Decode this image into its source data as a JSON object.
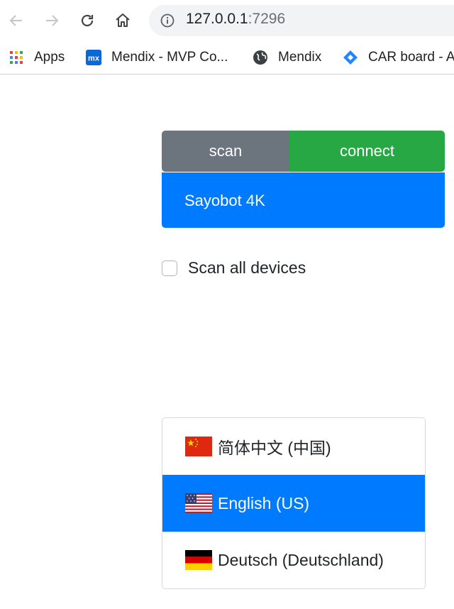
{
  "browser": {
    "url_host": "127.0.0.1",
    "url_port": ":7296",
    "bookmarks": [
      {
        "label": "Apps",
        "icon": "apps-grid-icon"
      },
      {
        "label": "Mendix - MVP Co...",
        "icon": "mendix-mx-icon"
      },
      {
        "label": "Mendix",
        "icon": "globe-icon"
      },
      {
        "label": "CAR board - A",
        "icon": "jira-diamond-icon"
      }
    ]
  },
  "device_panel": {
    "scan_label": "scan",
    "connect_label": "connect",
    "devices": [
      "Sayobot 4K"
    ],
    "scan_all_label": "Scan all devices",
    "scan_all_checked": false
  },
  "languages": {
    "items": [
      {
        "label": "简体中文 (中国)",
        "flag": "cn-flag-icon",
        "active": false
      },
      {
        "label": "English (US)",
        "flag": "us-flag-icon",
        "active": true
      },
      {
        "label": "Deutsch (Deutschland)",
        "flag": "de-flag-icon",
        "active": false
      }
    ]
  },
  "colors": {
    "primary": "#007bff",
    "secondary": "#6c757d",
    "success": "#28a745"
  }
}
